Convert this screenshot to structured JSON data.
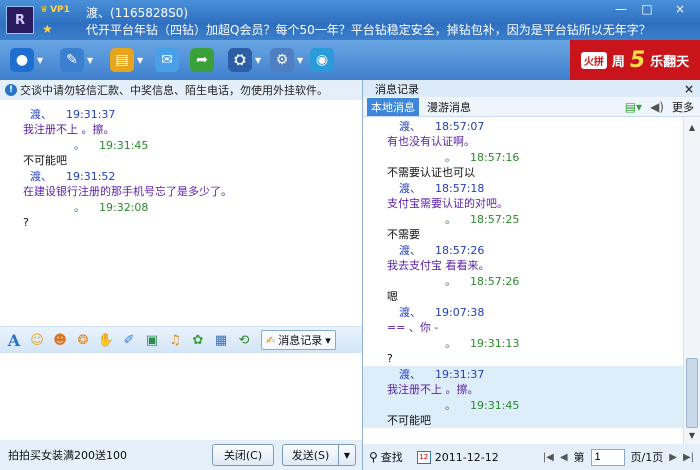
{
  "titlebar": {
    "avatar_letter": "R",
    "vip": "VP1",
    "contact_name": "渡、(1165828S0)",
    "signature": "代开平台年钻（四钻）加超Q会员？每个50一年？平台钻稳定安全，掉钻包补，因为是平台钻所以无年字？",
    "window_buttons": [
      "—",
      "□",
      "×"
    ]
  },
  "toolbar": {
    "items": [
      {
        "icon": "webcam-icon",
        "glyph": "●",
        "color": "#1e6fd0"
      },
      {
        "icon": "microphone-icon",
        "glyph": "✎",
        "color": "#3a7fd0"
      },
      {
        "icon": "folder-icon",
        "glyph": "▤",
        "color": "#e6a51c"
      },
      {
        "icon": "mail-icon",
        "glyph": "✉",
        "color": "#4aa0e8"
      },
      {
        "icon": "send-file-icon",
        "glyph": "➦",
        "color": "#3aa03a"
      },
      {
        "icon": "remote-assist-icon",
        "glyph": "⛭",
        "color": "#2d5fa8"
      },
      {
        "icon": "app-icon",
        "glyph": "⚙",
        "color": "#4f7fc0"
      },
      {
        "icon": "browser-icon",
        "glyph": "◉",
        "color": "#2a9ad8"
      }
    ],
    "ad": {
      "tag": "火拼",
      "prefix": "周",
      "number": "5",
      "suffix": "乐翻天"
    }
  },
  "notice": {
    "text": "交谈中请勿轻信汇款、中奖信息、陌生电话，勿使用外挂软件。"
  },
  "chat": {
    "messages": [
      {
        "sender": "渡、",
        "time": "19:31:37",
        "self": false,
        "text": "我注册不上 。擦。",
        "color": "purple"
      },
      {
        "sender": "。",
        "time": "19:31:45",
        "self": true,
        "text": "不可能吧",
        "color": "black"
      },
      {
        "sender": "渡、",
        "time": "19:31:52",
        "self": false,
        "text": "在建设银行注册的那手机号忘了是多少了。",
        "color": "purple"
      },
      {
        "sender": "。",
        "time": "19:32:08",
        "self": true,
        "text": "?",
        "color": "black"
      }
    ]
  },
  "format_bar": {
    "font_label": "A",
    "tools": [
      {
        "icon": "emoticon-icon",
        "glyph": "☺",
        "color": "#e6a51c"
      },
      {
        "icon": "magic-emoticon-icon",
        "glyph": "☻",
        "color": "#d9731c"
      },
      {
        "icon": "shake-icon",
        "glyph": "❂",
        "color": "#d98a1c"
      },
      {
        "icon": "voice-message-icon",
        "glyph": "✋",
        "color": "#d98a1c"
      },
      {
        "icon": "scribble-icon",
        "glyph": "✐",
        "color": "#3a7fd0"
      },
      {
        "icon": "screenshot-icon",
        "glyph": "▣",
        "color": "#2a8a4a"
      },
      {
        "icon": "music-icon",
        "glyph": "♫",
        "color": "#e08a1c"
      },
      {
        "icon": "gift-icon",
        "glyph": "✿",
        "color": "#3aa03a"
      },
      {
        "icon": "picture-icon",
        "glyph": "▦",
        "color": "#3a6fb0"
      },
      {
        "icon": "send-picture-icon",
        "glyph": "⟲",
        "color": "#2a8a2a"
      }
    ],
    "history_button": "消息记录"
  },
  "bottom_bar": {
    "promo_text": "拍拍买女装满200送100",
    "close_label": "关闭(C)",
    "send_label": "发送(S)",
    "send_dropdown": "▼"
  },
  "right_pane": {
    "title": "消息记录",
    "tabs": [
      "本地消息",
      "漫游消息"
    ],
    "more_label": "更多",
    "history": [
      {
        "sender": "渡、",
        "time": "18:57:07",
        "self": false,
        "text": "有也没有认证啊。",
        "color": "purple"
      },
      {
        "sender": "。",
        "time": "18:57:16",
        "self": true,
        "text": "不需要认证也可以",
        "color": "black"
      },
      {
        "sender": "渡、",
        "time": "18:57:18",
        "self": false,
        "text": "支付宝需要认证的对吧。",
        "color": "purple"
      },
      {
        "sender": "。",
        "time": "18:57:25",
        "self": true,
        "text": "不需要",
        "color": "black"
      },
      {
        "sender": "渡、",
        "time": "18:57:26",
        "self": false,
        "text": "我去支付宝 看看来。",
        "color": "purple"
      },
      {
        "sender": "。",
        "time": "18:57:26",
        "self": true,
        "text": "嗯",
        "color": "black"
      },
      {
        "sender": "渡、",
        "time": "19:07:38",
        "self": false,
        "text": "== 、你 -",
        "color": "purple"
      },
      {
        "sender": "。",
        "time": "19:31:13",
        "self": true,
        "text": "?",
        "color": "black"
      },
      {
        "sender": "渡、",
        "time": "19:31:37",
        "self": false,
        "text": "我注册不上 。擦。",
        "color": "purple"
      },
      {
        "sender": "。",
        "time": "19:31:45",
        "self": true,
        "text": "不可能吧",
        "color": "black"
      }
    ],
    "search_label": "查找",
    "date": "2011-12-12",
    "page_prefix": "第",
    "page_value": "1",
    "page_total": "页/1页"
  }
}
